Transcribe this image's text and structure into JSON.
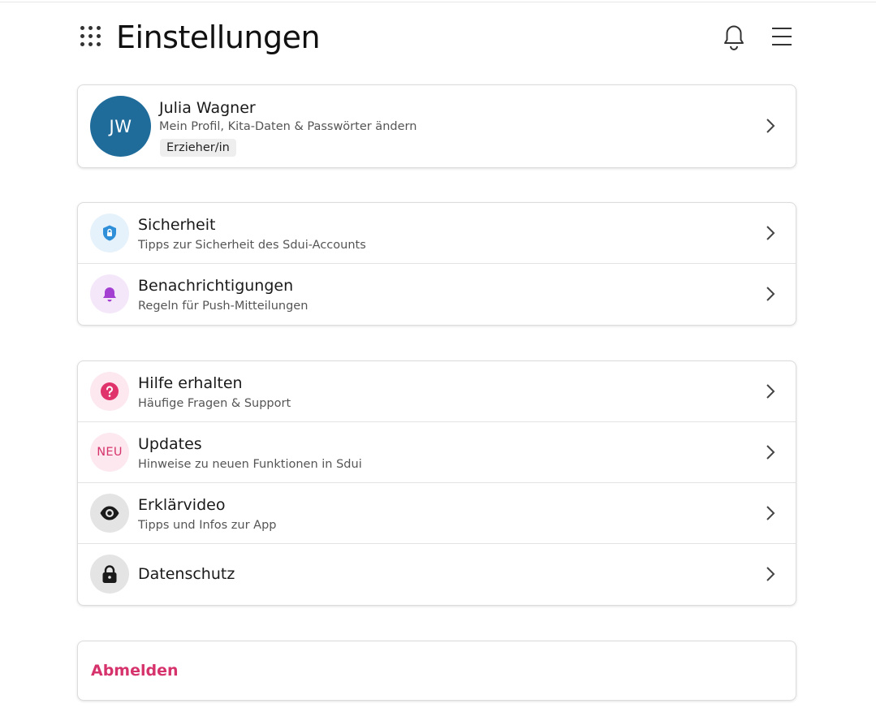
{
  "header": {
    "title": "Einstellungen",
    "apps_icon": "grid-dots-icon",
    "bell_icon": "bell-icon",
    "menu_icon": "hamburger-menu-icon"
  },
  "profile": {
    "initials": "JW",
    "name": "Julia Wagner",
    "description": "Mein Profil, Kita-Daten & Passwörter ändern",
    "role": "Erzieher/in",
    "avatar_color": "#1f6b9a"
  },
  "sections": {
    "security": {
      "title": "Sicherheit",
      "subtitle": "Tipps zur Sicherheit des Sdui-Accounts",
      "icon": "shield-icon",
      "color": "#2f8fd8",
      "bg": "#e6f2fb"
    },
    "notifications": {
      "title": "Benachrichtigungen",
      "subtitle": "Regeln für Push-Mitteilungen",
      "icon": "bell-icon",
      "color": "#a33fd1",
      "bg": "#f4e7fa"
    },
    "help": {
      "title": "Hilfe erhalten",
      "subtitle": "Häufige Fragen & Support",
      "icon": "question-icon",
      "color": "#e0336c",
      "bg": "#fce8ee"
    },
    "updates": {
      "title": "Updates",
      "subtitle": "Hinweise zu neuen Funktionen in Sdui",
      "badge": "NEU",
      "color": "#d6336c",
      "bg": "#fce8ee"
    },
    "video": {
      "title": "Erklärvideo",
      "subtitle": "Tipps und Infos zur App",
      "icon": "eye-icon",
      "color": "#1a1a1a",
      "bg": "#e4e4e4"
    },
    "privacy": {
      "title": "Datenschutz",
      "icon": "lock-icon",
      "color": "#1a1a1a",
      "bg": "#e4e4e4"
    }
  },
  "logout": {
    "label": "Abmelden",
    "color": "#d6336c"
  }
}
